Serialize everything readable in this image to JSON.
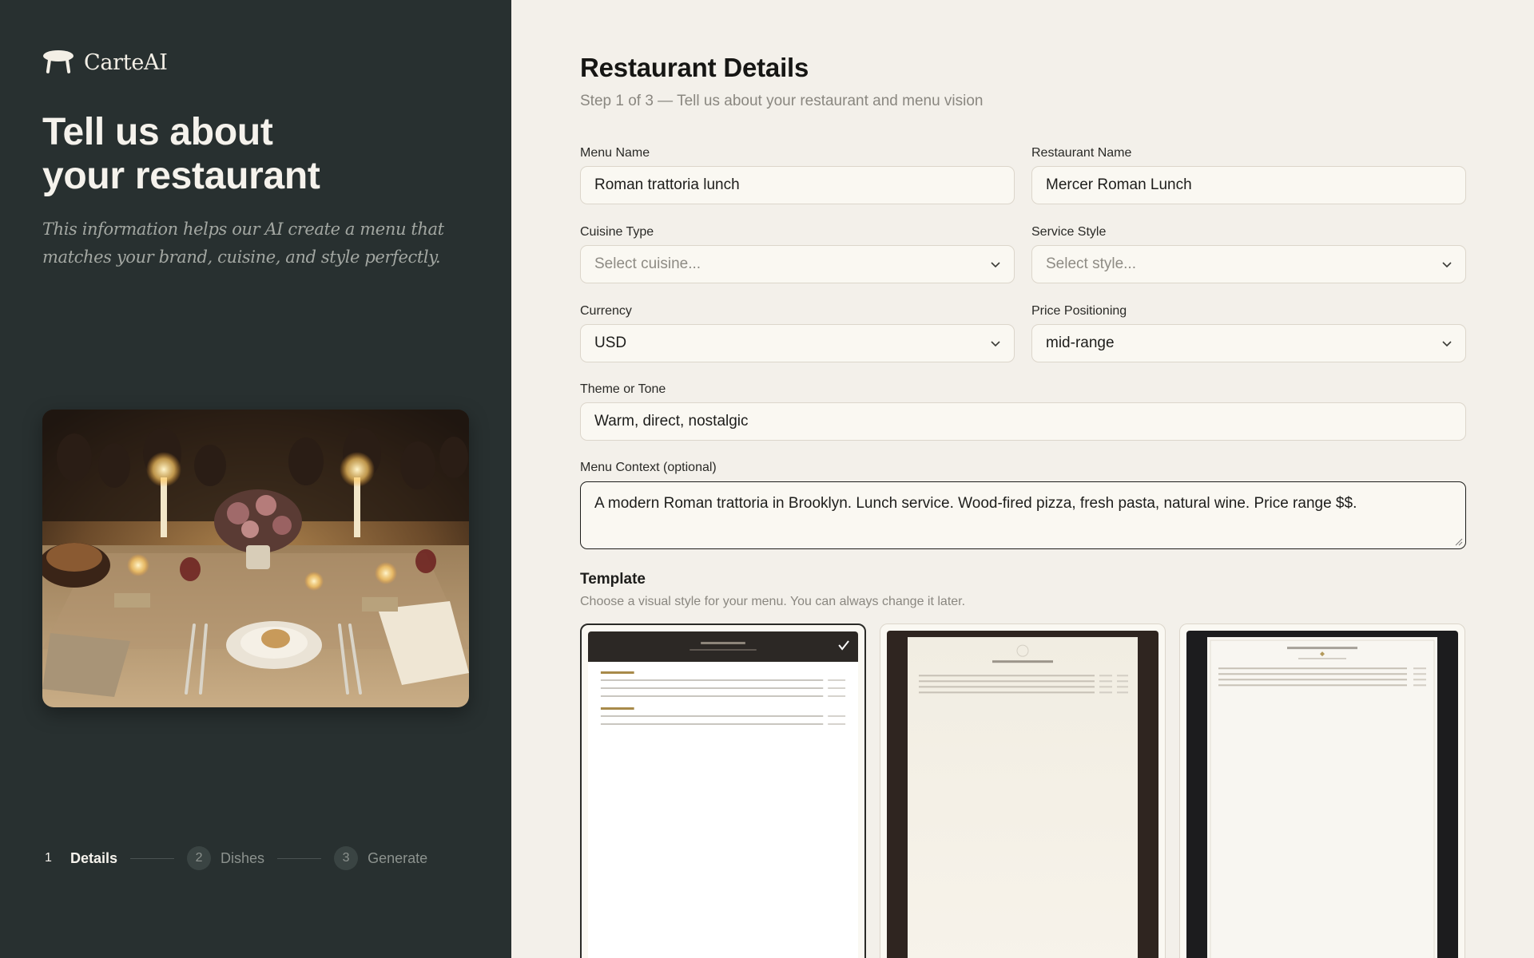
{
  "brand": {
    "name": "CarteAI",
    "logo_icon": "table-icon"
  },
  "hero": {
    "title_line1": "Tell us about",
    "title_line2": "your restaurant",
    "subtitle": "This information helps our AI create a menu that matches your brand, cuisine, and style perfectly."
  },
  "steps": [
    {
      "number": "1",
      "label": "Details",
      "active": true
    },
    {
      "number": "2",
      "label": "Dishes",
      "active": false
    },
    {
      "number": "3",
      "label": "Generate",
      "active": false
    }
  ],
  "form": {
    "title": "Restaurant Details",
    "subtitle": "Step 1 of 3 — Tell us about your restaurant and menu vision",
    "menu_name": {
      "label": "Menu Name",
      "value": "Roman trattoria lunch"
    },
    "restaurant_name": {
      "label": "Restaurant Name",
      "value": "Mercer Roman Lunch"
    },
    "cuisine_type": {
      "label": "Cuisine Type",
      "placeholder": "Select cuisine..."
    },
    "service_style": {
      "label": "Service Style",
      "placeholder": "Select style..."
    },
    "currency": {
      "label": "Currency",
      "value": "USD"
    },
    "price_positioning": {
      "label": "Price Positioning",
      "value": "mid-range"
    },
    "theme": {
      "label": "Theme or Tone",
      "value": "Warm, direct, nostalgic"
    },
    "context": {
      "label": "Menu Context (optional)",
      "value": "A modern Roman trattoria in Brooklyn. Lunch service. Wood-fired pizza, fresh pasta, natural wine. Price range $$."
    }
  },
  "template": {
    "title": "Template",
    "subtitle": "Choose a visual style for your menu. You can always change it later.",
    "cards": [
      {
        "name": "dark-header-template",
        "selected": true
      },
      {
        "name": "brown-frame-template",
        "selected": false
      },
      {
        "name": "black-frame-template",
        "selected": false
      }
    ]
  },
  "colors": {
    "sidebar_bg": "#283030",
    "page_bg": "#f3f0ea",
    "accent_gold": "#a88a4a",
    "text_dark": "#1d1d1b"
  }
}
